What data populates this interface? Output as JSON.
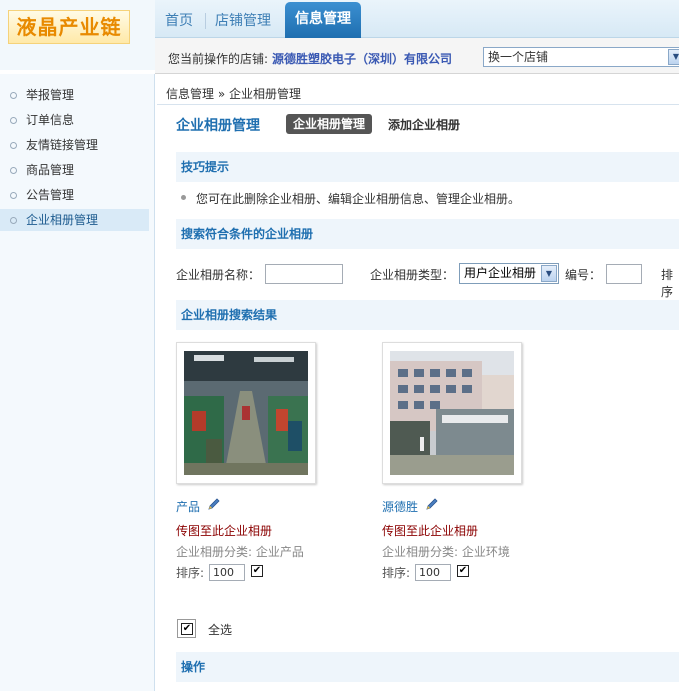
{
  "logo": {
    "text": "液晶产业链"
  },
  "topnav": {
    "items": [
      {
        "label": "首页"
      },
      {
        "label": "店铺管理"
      },
      {
        "label": "信息管理"
      }
    ]
  },
  "storebar": {
    "label": "您当前操作的店铺:",
    "store_name": "源德胜塑胶电子（深圳）有限公司",
    "switch_select": "换一个店铺"
  },
  "sidebar": {
    "items": [
      {
        "label": "举报管理"
      },
      {
        "label": "订单信息"
      },
      {
        "label": "友情链接管理"
      },
      {
        "label": "商品管理"
      },
      {
        "label": "公告管理"
      },
      {
        "label": "企业相册管理"
      }
    ]
  },
  "breadcrumb": {
    "text": "信息管理 » 企业相册管理"
  },
  "page": {
    "title": "企业相册管理",
    "tab_active": "企业相册管理",
    "tab_add": "添加企业相册"
  },
  "tips": {
    "heading": "技巧提示",
    "text": "您可在此删除企业相册、编辑企业相册信息、管理企业相册。"
  },
  "search": {
    "heading": "搜索符合条件的企业相册",
    "name_label": "企业相册名称：",
    "name_value": "",
    "type_label": "企业相册类型：",
    "type_value": "用户企业相册",
    "id_label": "编号：",
    "id_value": "",
    "sort_label": "排序"
  },
  "results": {
    "heading": "企业相册搜索结果",
    "albums": [
      {
        "name": "产品",
        "upload": "传图至此企业相册",
        "category": "企业相册分类: 企业产品",
        "sort_label": "排序:",
        "sort_value": "100",
        "checked": "✔"
      },
      {
        "name": "源德胜",
        "upload": "传图至此企业相册",
        "category": "企业相册分类: 企业环境",
        "sort_label": "排序:",
        "sort_value": "100",
        "checked": "✔"
      }
    ],
    "select_all": "全选",
    "select_all_check": "✔"
  },
  "actions": {
    "heading": "操作"
  }
}
